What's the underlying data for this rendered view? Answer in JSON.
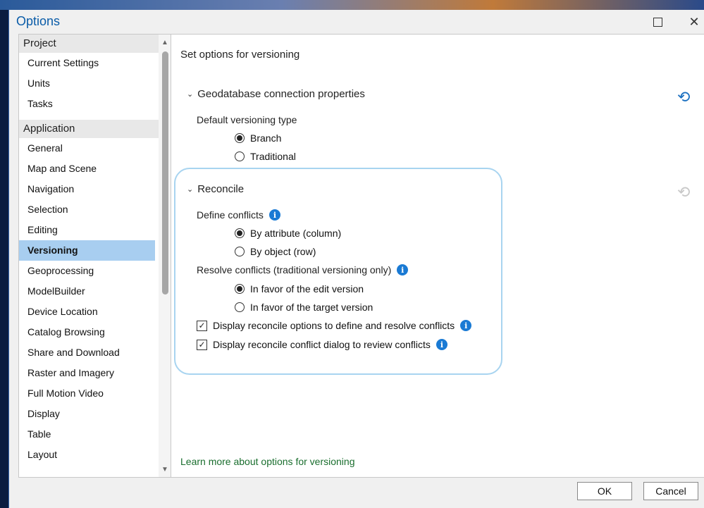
{
  "window": {
    "title": "Options",
    "maximize_icon": "maximize-icon",
    "close_icon": "close-icon",
    "close_glyph": "✕"
  },
  "sidebar": {
    "groups": [
      {
        "label": "Project",
        "items": [
          "Current Settings",
          "Units",
          "Tasks"
        ]
      },
      {
        "label": "Application",
        "items": [
          "General",
          "Map and Scene",
          "Navigation",
          "Selection",
          "Editing",
          "Versioning",
          "Geoprocessing",
          "ModelBuilder",
          "Device Location",
          "Catalog Browsing",
          "Share and Download",
          "Raster and Imagery",
          "Full Motion Video",
          "Display",
          "Table",
          "Layout"
        ]
      }
    ],
    "selected": "Versioning"
  },
  "content": {
    "title": "Set options for versioning",
    "geodatabase": {
      "header": "Geodatabase connection properties",
      "default_type_label": "Default versioning type",
      "options": [
        "Branch",
        "Traditional"
      ],
      "selected": "Branch"
    },
    "reconcile": {
      "header": "Reconcile",
      "define_label": "Define conflicts",
      "define_options": [
        "By attribute (column)",
        "By object (row)"
      ],
      "define_selected": "By attribute (column)",
      "resolve_label": "Resolve conflicts (traditional versioning only)",
      "resolve_options": [
        "In favor of the edit version",
        "In favor of the target version"
      ],
      "resolve_selected": "In favor of the edit version",
      "checkbox_1": "Display reconcile options to define and resolve conflicts",
      "checkbox_2": "Display reconcile conflict dialog to review conflicts",
      "checkbox_1_checked": true,
      "checkbox_2_checked": true
    },
    "learn_more": "Learn more about options for versioning"
  },
  "buttons": {
    "ok": "OK",
    "cancel": "Cancel"
  },
  "colors": {
    "title": "#0a5ca8",
    "selected_item": "#a8cef0",
    "info_icon": "#1a7ad4",
    "link": "#1a6e2e",
    "highlight": "#a8d4f0"
  }
}
